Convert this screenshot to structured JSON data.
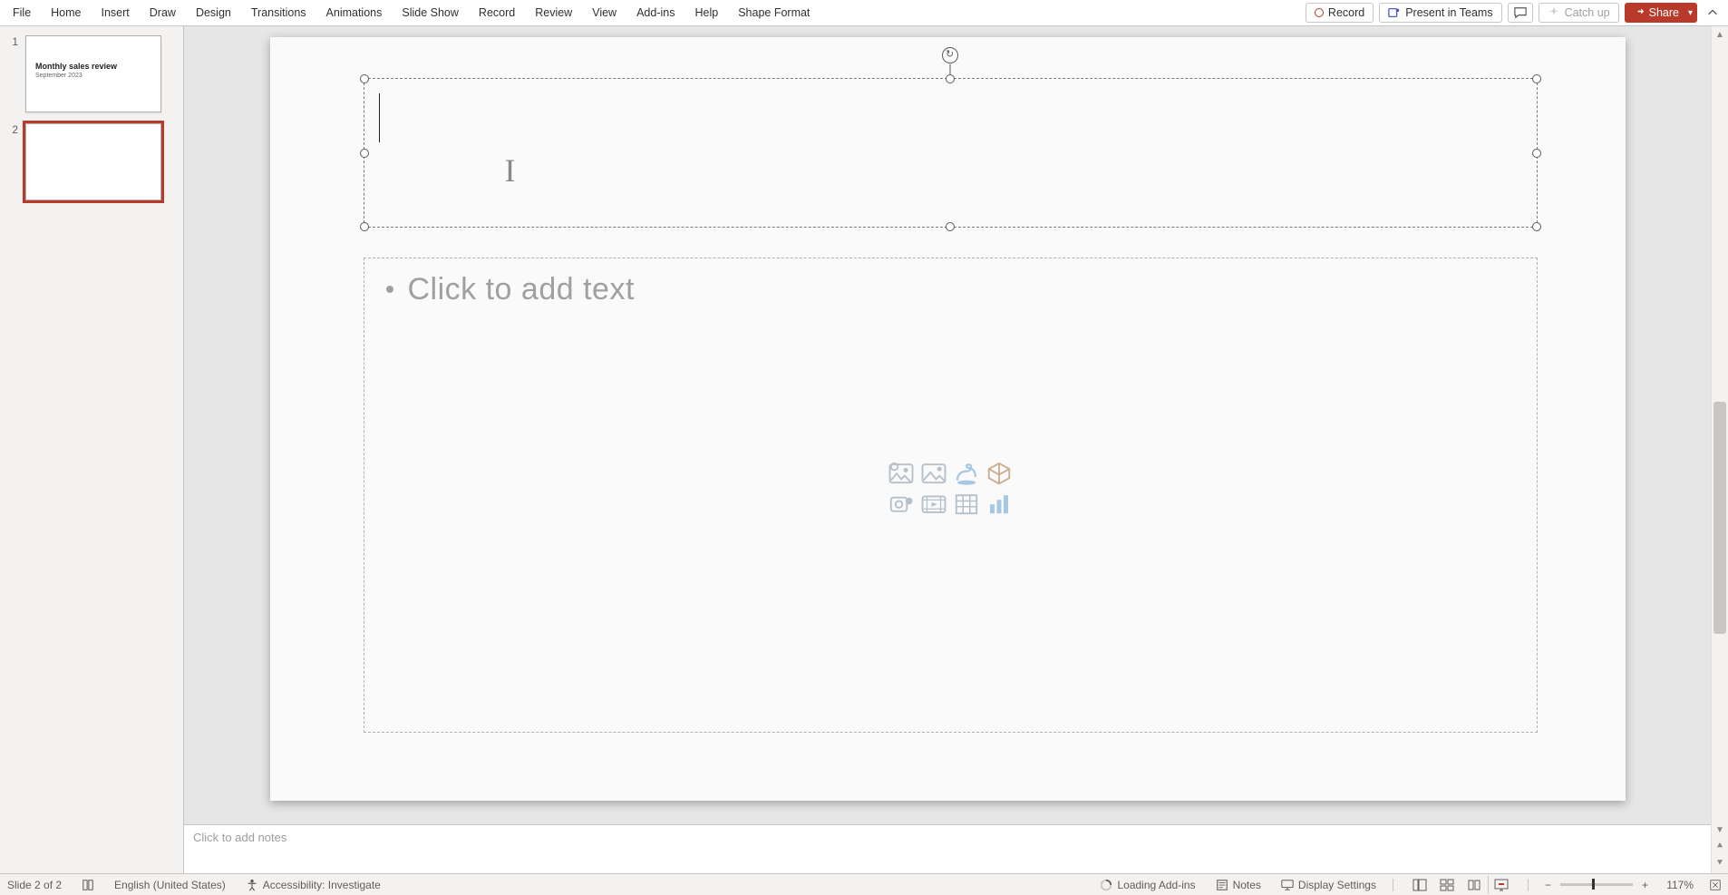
{
  "ribbon": {
    "tabs": [
      "File",
      "Home",
      "Insert",
      "Draw",
      "Design",
      "Transitions",
      "Animations",
      "Slide Show",
      "Record",
      "Review",
      "View",
      "Add-ins",
      "Help",
      "Shape Format"
    ],
    "record_label": "Record",
    "present_label": "Present in Teams",
    "catchup_label": "Catch up",
    "share_label": "Share"
  },
  "thumbnails": [
    {
      "number": "1",
      "title": "Monthly sales review",
      "subtitle": "September 2023"
    },
    {
      "number": "2",
      "title": "",
      "subtitle": ""
    }
  ],
  "selected_thumbnail_index": 1,
  "slide": {
    "content_placeholder_text": "Click to add text",
    "insert_icons": [
      "insert-stock-images-icon",
      "insert-pictures-icon",
      "insert-icons-icon",
      "insert-3d-model-icon",
      "insert-cameo-icon",
      "insert-video-icon",
      "insert-table-icon",
      "insert-chart-icon"
    ]
  },
  "notes": {
    "placeholder": "Click to add notes"
  },
  "status": {
    "slide_position": "Slide 2 of 2",
    "language": "English (United States)",
    "accessibility": "Accessibility: Investigate",
    "loading_addins": "Loading Add-ins",
    "notes_label": "Notes",
    "display_settings": "Display Settings",
    "zoom_percent": "117%"
  }
}
